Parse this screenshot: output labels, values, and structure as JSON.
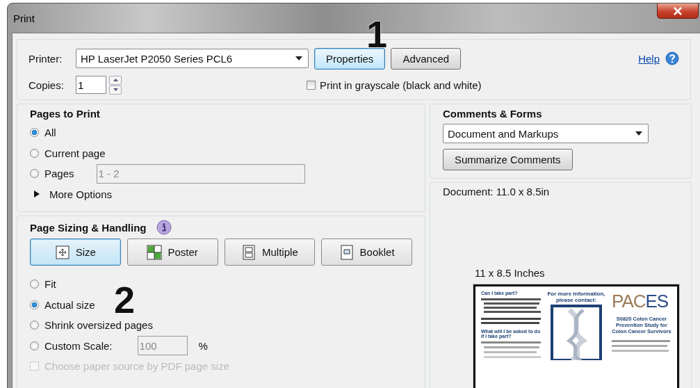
{
  "window": {
    "title": "Print"
  },
  "printer": {
    "label": "Printer:",
    "value": "HP LaserJet P2050 Series PCL6"
  },
  "buttons": [
    {
      "label": "Properties",
      "focused": true
    },
    {
      "label": "Advanced",
      "focused": false
    }
  ],
  "help": {
    "label": "Help"
  },
  "copies": {
    "label": "Copies:",
    "value": "1"
  },
  "grayscale": {
    "label": "Print in grayscale (black and white)",
    "checked": false
  },
  "pages_to_print": {
    "title": "Pages to Print",
    "options": [
      {
        "label": "All",
        "selected": true
      },
      {
        "label": "Current page",
        "selected": false
      },
      {
        "label": "Pages",
        "selected": false
      }
    ],
    "range_value": "1 - 2",
    "more_options": {
      "label": "More Options",
      "expanded": false
    }
  },
  "page_sizing": {
    "title": "Page Sizing & Handling",
    "modes": [
      {
        "label": "Size",
        "selected": true
      },
      {
        "label": "Poster",
        "selected": false
      },
      {
        "label": "Multiple",
        "selected": false
      },
      {
        "label": "Booklet",
        "selected": false
      }
    ],
    "scaling": [
      {
        "label": "Fit",
        "selected": false
      },
      {
        "label": "Actual size",
        "selected": true
      },
      {
        "label": "Shrink oversized pages",
        "selected": false
      },
      {
        "label": "Custom Scale:",
        "selected": false
      }
    ],
    "scale_value": "100",
    "scale_unit": "%",
    "paper_source": {
      "label": "Choose paper source by PDF page size",
      "checked": false,
      "disabled": true
    }
  },
  "comments_forms": {
    "title": "Comments & Forms",
    "value": "Document and Markups",
    "summarize_button": "Summarize Comments"
  },
  "preview": {
    "document_size": "Document: 11.0 x 8.5in",
    "page_size": "11 x 8.5 Inches",
    "page": {
      "left_headings": [
        "Can I take part?",
        "What will I be asked to do if I take part?"
      ],
      "contact": "For more information, please contact:",
      "logo": [
        "PAC",
        "ES"
      ],
      "study_title": "S0820 Colon Cancer Prevention Study for Colon Cancer Survivors"
    }
  },
  "callouts": [
    {
      "label": "1"
    },
    {
      "label": "2"
    }
  ]
}
